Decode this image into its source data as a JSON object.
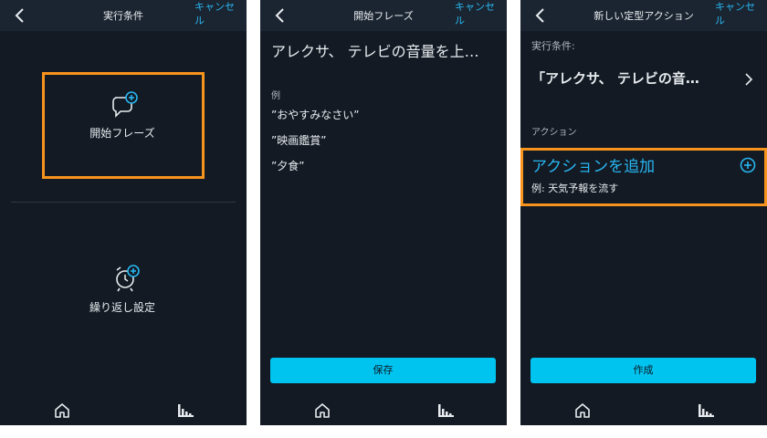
{
  "panel1": {
    "title": "実行条件",
    "cancel": "キャンセル",
    "start_phrase_label": "開始フレーズ",
    "repeat_label": "繰り返し設定"
  },
  "panel2": {
    "title": "開始フレーズ",
    "cancel": "キャンセル",
    "phrase_value": "アレクサ、 テレビの音量を上…",
    "examples_label": "例",
    "examples": [
      "”おやすみなさい”",
      "”映画鑑賞”",
      "”夕食”"
    ],
    "save_label": "保存"
  },
  "panel3": {
    "title": "新しい定型アクション",
    "cancel": "キャンセル",
    "condition_label": "実行条件:",
    "condition_value": "「アレクサ、 テレビの音…",
    "action_section_label": "アクション",
    "add_action_label": "アクションを追加",
    "add_action_example": "例: 天気予報を流す",
    "create_label": "作成"
  },
  "colors": {
    "background": "#131a24",
    "header": "#1b2531",
    "accent": "#00c4f0",
    "link": "#28b6f0",
    "highlight": "#f7941d"
  },
  "icons": [
    "back-icon",
    "speech-plus-icon",
    "alarm-plus-icon",
    "chevron-right-icon",
    "add-circle-icon",
    "home-icon",
    "activity-icon"
  ]
}
